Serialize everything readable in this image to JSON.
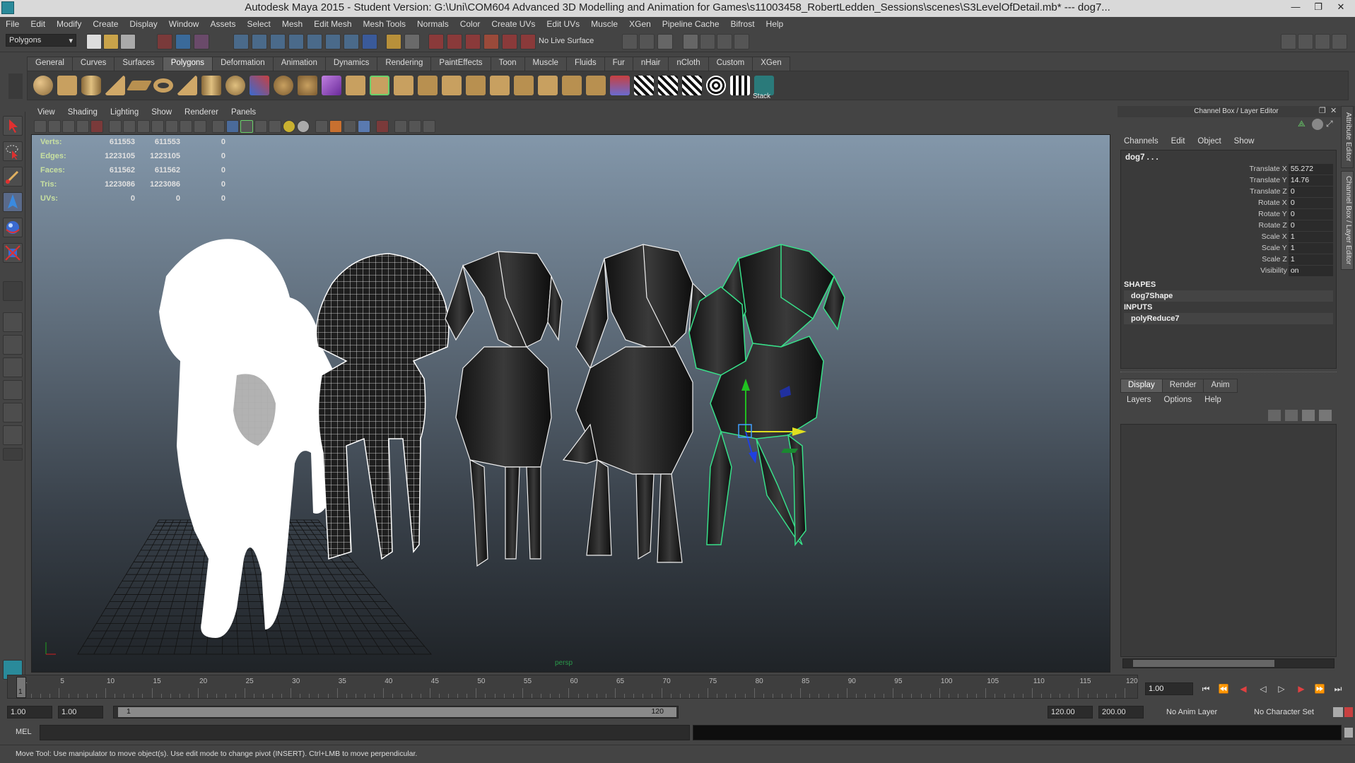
{
  "titlebar": {
    "title": "Autodesk Maya 2015 - Student Version: G:\\Uni\\COM604 Advanced 3D Modelling and Animation for Games\\s11003458_RobertLedden_Sessions\\scenes\\S3LevelOfDetail.mb*   ---   dog7...",
    "minimize": "—",
    "restore": "❐",
    "close": "✕"
  },
  "menubar": [
    "File",
    "Edit",
    "Modify",
    "Create",
    "Display",
    "Window",
    "Assets",
    "Select",
    "Mesh",
    "Edit Mesh",
    "Mesh Tools",
    "Normals",
    "Color",
    "Create UVs",
    "Edit UVs",
    "Muscle",
    "XGen",
    "Pipeline Cache",
    "Bifrost",
    "Help"
  ],
  "statusline": {
    "menu_set": "Polygons",
    "live_surface": "No Live Surface"
  },
  "shelf": {
    "tabs": [
      "General",
      "Curves",
      "Surfaces",
      "Polygons",
      "Deformation",
      "Animation",
      "Dynamics",
      "Rendering",
      "PaintEffects",
      "Toon",
      "Muscle",
      "Fluids",
      "Fur",
      "nHair",
      "nCloth",
      "Custom",
      "XGen"
    ],
    "active_tab": "Polygons",
    "stack_label": "Stack"
  },
  "viewport": {
    "menu": [
      "View",
      "Shading",
      "Lighting",
      "Show",
      "Renderer",
      "Panels"
    ],
    "camera": "persp",
    "hud": [
      {
        "label": "Verts:",
        "a": "611553",
        "b": "611553",
        "c": "0"
      },
      {
        "label": "Edges:",
        "a": "1223105",
        "b": "1223105",
        "c": "0"
      },
      {
        "label": "Faces:",
        "a": "611562",
        "b": "611562",
        "c": "0"
      },
      {
        "label": "Tris:",
        "a": "1223086",
        "b": "1223086",
        "c": "0"
      },
      {
        "label": "UVs:",
        "a": "0",
        "b": "0",
        "c": "0"
      }
    ]
  },
  "channelbox": {
    "header": "Channel Box / Layer Editor",
    "menu": [
      "Channels",
      "Edit",
      "Object",
      "Show"
    ],
    "object": "dog7 . . .",
    "attributes": [
      {
        "name": "Translate X",
        "value": "55.272"
      },
      {
        "name": "Translate Y",
        "value": "14.76"
      },
      {
        "name": "Translate Z",
        "value": "0"
      },
      {
        "name": "Rotate X",
        "value": "0"
      },
      {
        "name": "Rotate Y",
        "value": "0"
      },
      {
        "name": "Rotate Z",
        "value": "0"
      },
      {
        "name": "Scale X",
        "value": "1"
      },
      {
        "name": "Scale Y",
        "value": "1"
      },
      {
        "name": "Scale Z",
        "value": "1"
      },
      {
        "name": "Visibility",
        "value": "on"
      }
    ],
    "shapes_header": "SHAPES",
    "shape": "dog7Shape",
    "inputs_header": "INPUTS",
    "input": "polyReduce7"
  },
  "layereditor": {
    "tabs": [
      "Display",
      "Render",
      "Anim"
    ],
    "active_tab": "Display",
    "menu": [
      "Layers",
      "Options",
      "Help"
    ]
  },
  "side_tabs": [
    "Attribute Editor",
    "Channel Box / Layer Editor"
  ],
  "timeslider": {
    "ticks": [
      "1",
      "5",
      "10",
      "15",
      "20",
      "25",
      "30",
      "35",
      "40",
      "45",
      "50",
      "55",
      "60",
      "65",
      "70",
      "75",
      "80",
      "85",
      "90",
      "95",
      "100",
      "105",
      "110",
      "115",
      "120"
    ],
    "current_frame": "1",
    "current_time": "1.00"
  },
  "rangeslider": {
    "start_time": "1.00",
    "playback_start": "1.00",
    "range_start": "1",
    "range_end": "120",
    "playback_end": "120.00",
    "end_time": "200.00",
    "anim_layer": "No Anim Layer",
    "character_set": "No Character Set"
  },
  "mel": {
    "label": "MEL"
  },
  "status": {
    "help": "Move Tool: Use manipulator to move object(s). Use edit mode to change pivot (INSERT).  Ctrl+LMB to move perpendicular."
  }
}
